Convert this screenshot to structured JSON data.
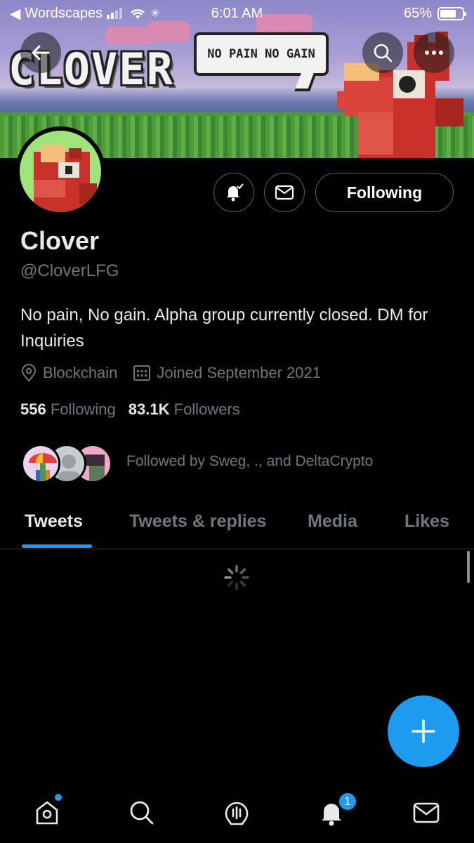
{
  "status_bar": {
    "back_app": "Wordscapes",
    "time": "6:01 AM",
    "battery": "65%"
  },
  "banner": {
    "title": "CLOVER",
    "speech_bubble": "NO PAIN NO GAIN"
  },
  "profile": {
    "name": "Clover",
    "handle": "@CloverLFG",
    "bio": "No pain, No gain. Alpha group currently closed. DM for Inquiries",
    "location": "Blockchain",
    "joined": "Joined September 2021",
    "following_count": "556",
    "following_label": "Following",
    "followers_count": "83.1K",
    "followers_label": "Followers",
    "followed_by": "Followed by Sweg, ., and DeltaCrypto"
  },
  "actions": {
    "follow_state": "Following"
  },
  "tabs": [
    {
      "label": "Tweets",
      "active": true
    },
    {
      "label": "Tweets & replies",
      "active": false
    },
    {
      "label": "Media",
      "active": false
    },
    {
      "label": "Likes",
      "active": false
    }
  ],
  "bottom_nav": {
    "notifications_badge": "1",
    "items": [
      "home-icon",
      "search-icon",
      "spaces-icon",
      "bell-icon",
      "mail-icon"
    ]
  },
  "colors": {
    "accent": "#1d9bf0",
    "background": "#000000",
    "secondary_text": "#71767b"
  }
}
